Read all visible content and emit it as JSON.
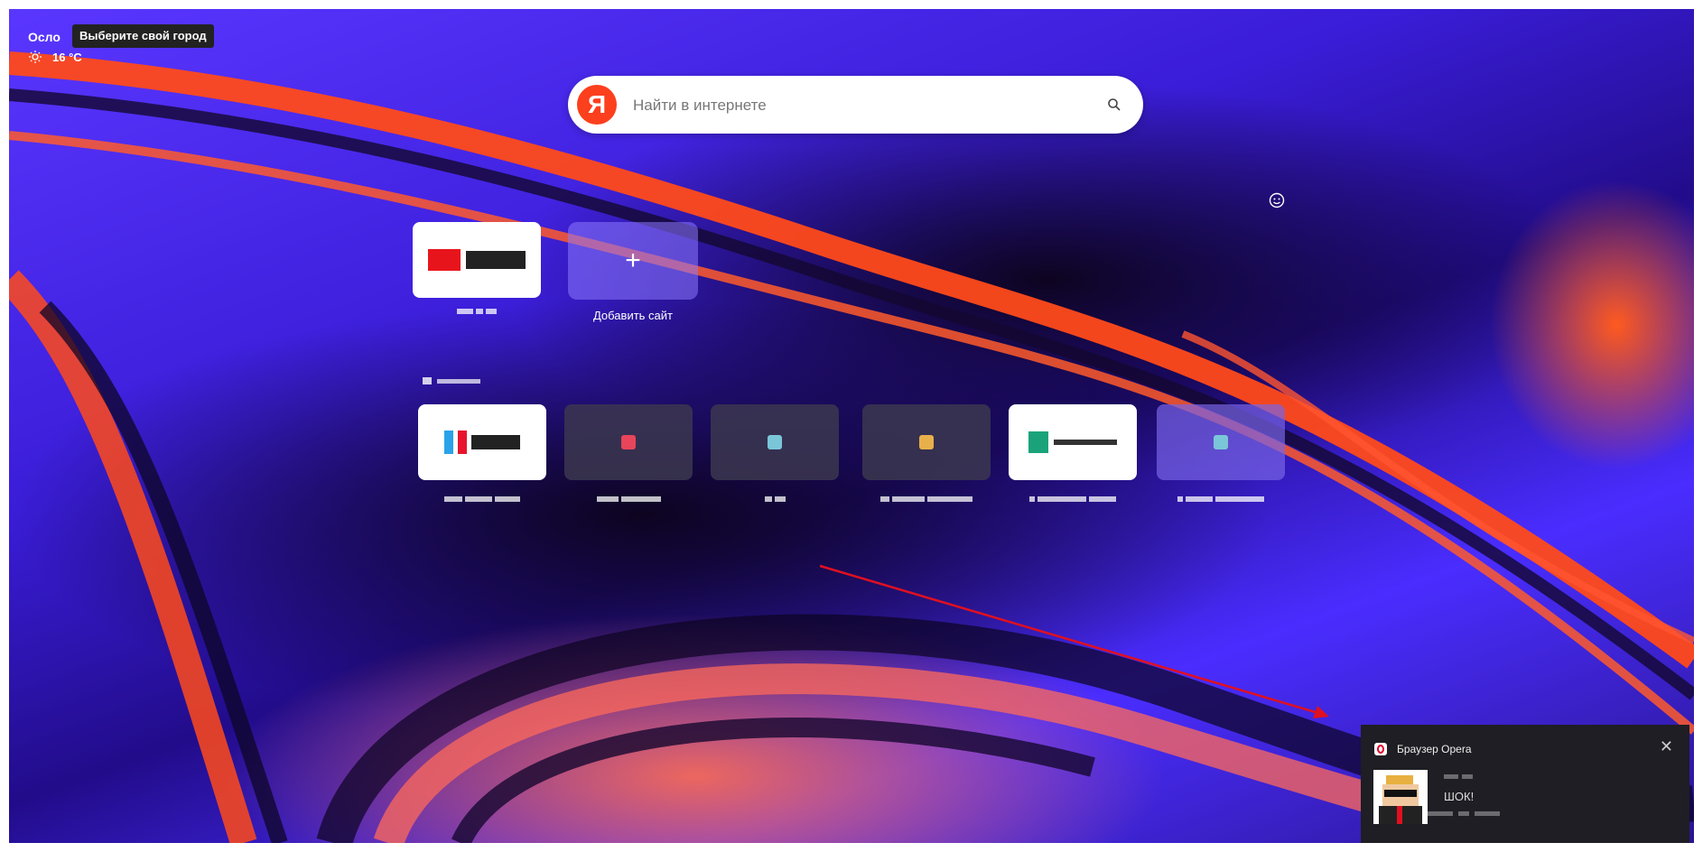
{
  "weather": {
    "city": "Осло",
    "city_tooltip": "Выберите свой город",
    "temperature": "16 °C",
    "icon": "sun-icon"
  },
  "search": {
    "logo_letter": "Я",
    "placeholder": "Найти в интернете",
    "icon": "search-icon"
  },
  "speed_dial": {
    "add_site_label": "Добавить сайт"
  },
  "notification": {
    "app_name": "Браузер Opera",
    "message": "ШОК!",
    "close_glyph": "✕"
  },
  "colors": {
    "yandex_red": "#fc3f1d",
    "background_purple": "#3a1dd8",
    "accent_orange": "#ff5a1f",
    "annotation_arrow": "#e01020"
  }
}
